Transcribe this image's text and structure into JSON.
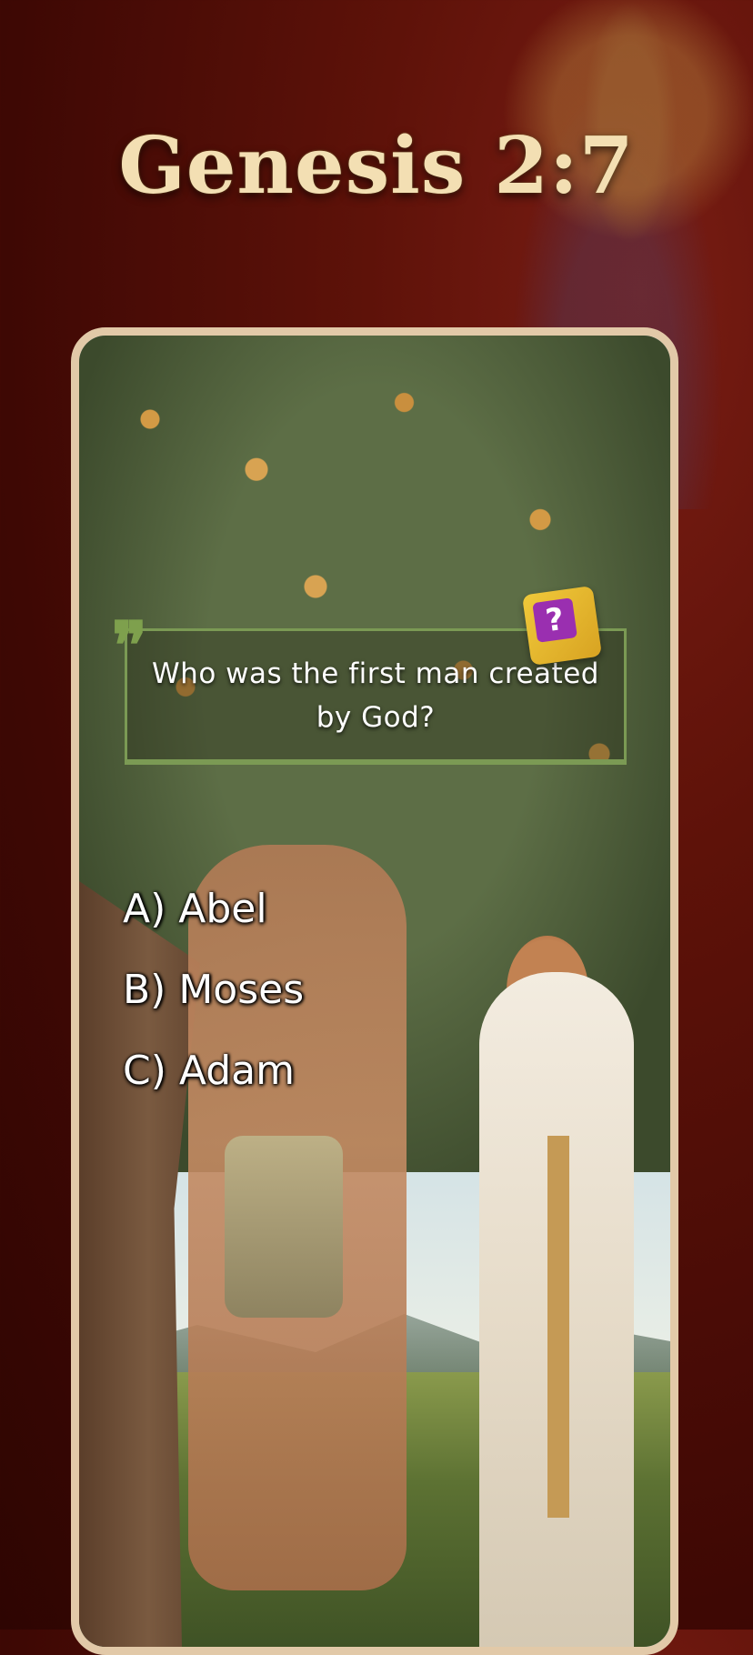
{
  "verse": {
    "title": "Genesis 2:7"
  },
  "quiz": {
    "question": "Who was the first man created by God?",
    "dice_symbol": "?",
    "answers": [
      {
        "label": "A) Abel"
      },
      {
        "label": "B) Moses"
      },
      {
        "label": "C) Adam"
      }
    ]
  },
  "colors": {
    "background": "#5e1209",
    "title": "#f3dfb3",
    "card_border": "#e2c9a8",
    "question_border": "#7b9a54",
    "dice": "#f0c93a",
    "dice_face": "#9a2fb0"
  },
  "icons": [
    "quote-icon",
    "dice-question-icon"
  ]
}
